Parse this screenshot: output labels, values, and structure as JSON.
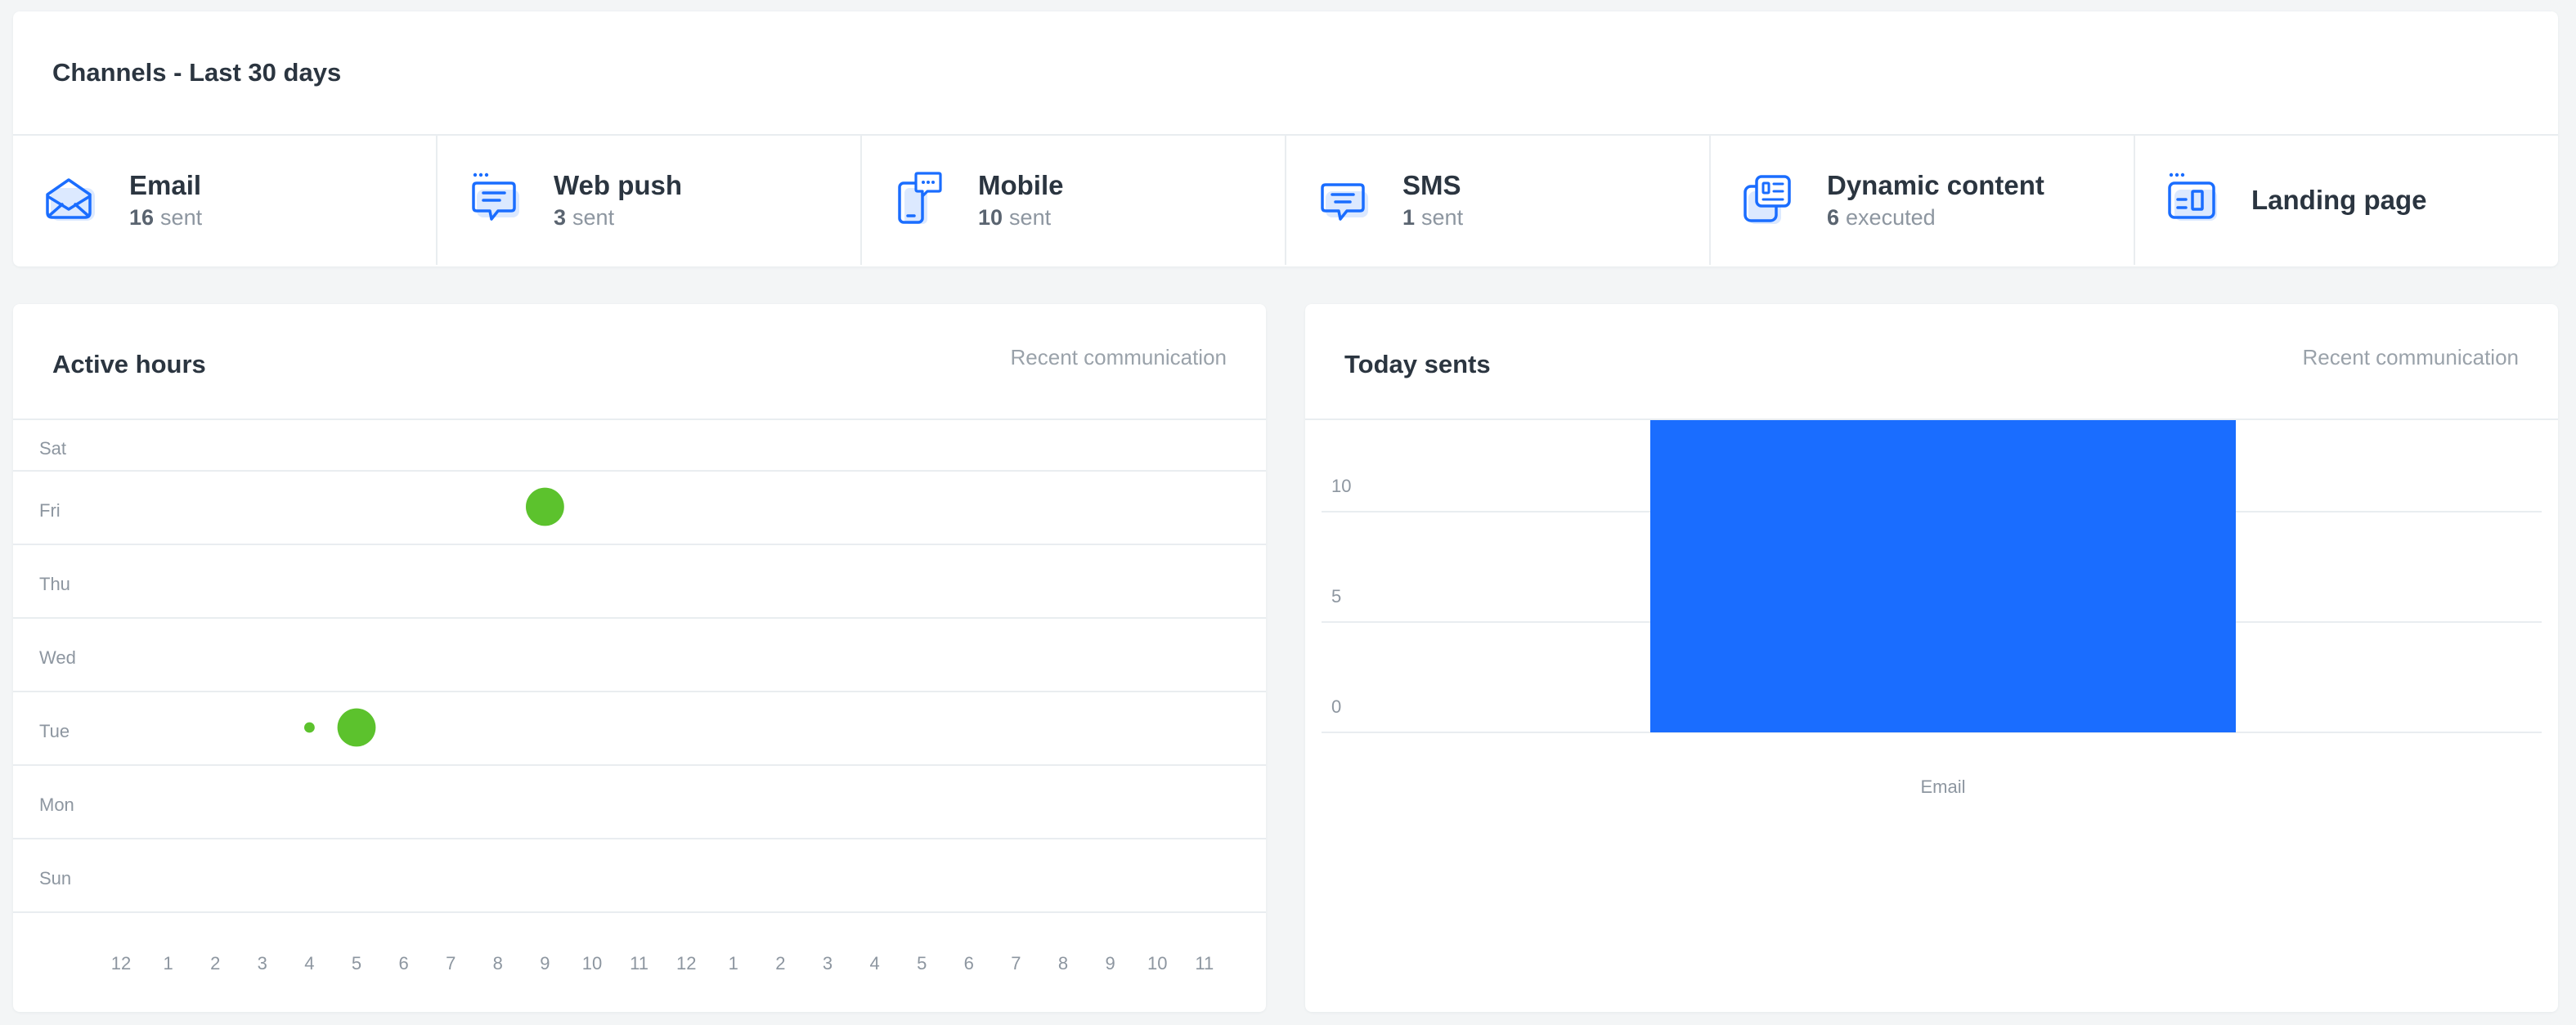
{
  "channels": {
    "title": "Channels - Last 30 days",
    "items": [
      {
        "key": "email",
        "name": "Email",
        "count": "16",
        "unit": "sent",
        "icon": "email-icon"
      },
      {
        "key": "web-push",
        "name": "Web push",
        "count": "3",
        "unit": "sent",
        "icon": "web-push-icon"
      },
      {
        "key": "mobile",
        "name": "Mobile",
        "count": "10",
        "unit": "sent",
        "icon": "mobile-icon"
      },
      {
        "key": "sms",
        "name": "SMS",
        "count": "1",
        "unit": "sent",
        "icon": "sms-icon"
      },
      {
        "key": "dynamic-content",
        "name": "Dynamic content",
        "count": "6",
        "unit": "executed",
        "icon": "dynamic-content-icon"
      },
      {
        "key": "landing-page",
        "name": "Landing page",
        "count": "",
        "unit": "",
        "icon": "landing-page-icon"
      }
    ]
  },
  "active_hours": {
    "title": "Active hours",
    "link": "Recent communication"
  },
  "today_sents": {
    "title": "Today sents",
    "link": "Recent communication"
  },
  "colors": {
    "accent": "#1a6dff",
    "dot": "#5cc22d",
    "grid": "#e9edf0"
  },
  "chart_data": [
    {
      "type": "scatter",
      "title": "Active hours",
      "y_categories": [
        "Sun",
        "Mon",
        "Tue",
        "Wed",
        "Thu",
        "Fri",
        "Sat"
      ],
      "x_categories": [
        "12",
        "1",
        "2",
        "3",
        "4",
        "5",
        "6",
        "7",
        "8",
        "9",
        "10",
        "11",
        "12",
        "1",
        "2",
        "3",
        "4",
        "5",
        "6",
        "7",
        "8",
        "9",
        "10",
        "11"
      ],
      "points": [
        {
          "x_index": 4,
          "y": "Tue",
          "size": 1
        },
        {
          "x_index": 5,
          "y": "Tue",
          "size": 6
        },
        {
          "x_index": 9,
          "y": "Fri",
          "size": 6
        }
      ],
      "grid": true
    },
    {
      "type": "bar",
      "title": "Today sents",
      "categories": [
        "Email"
      ],
      "values": [
        16
      ],
      "yticks": [
        0,
        5,
        10,
        15,
        20
      ],
      "ylim": [
        0,
        20
      ],
      "grid": true
    }
  ]
}
